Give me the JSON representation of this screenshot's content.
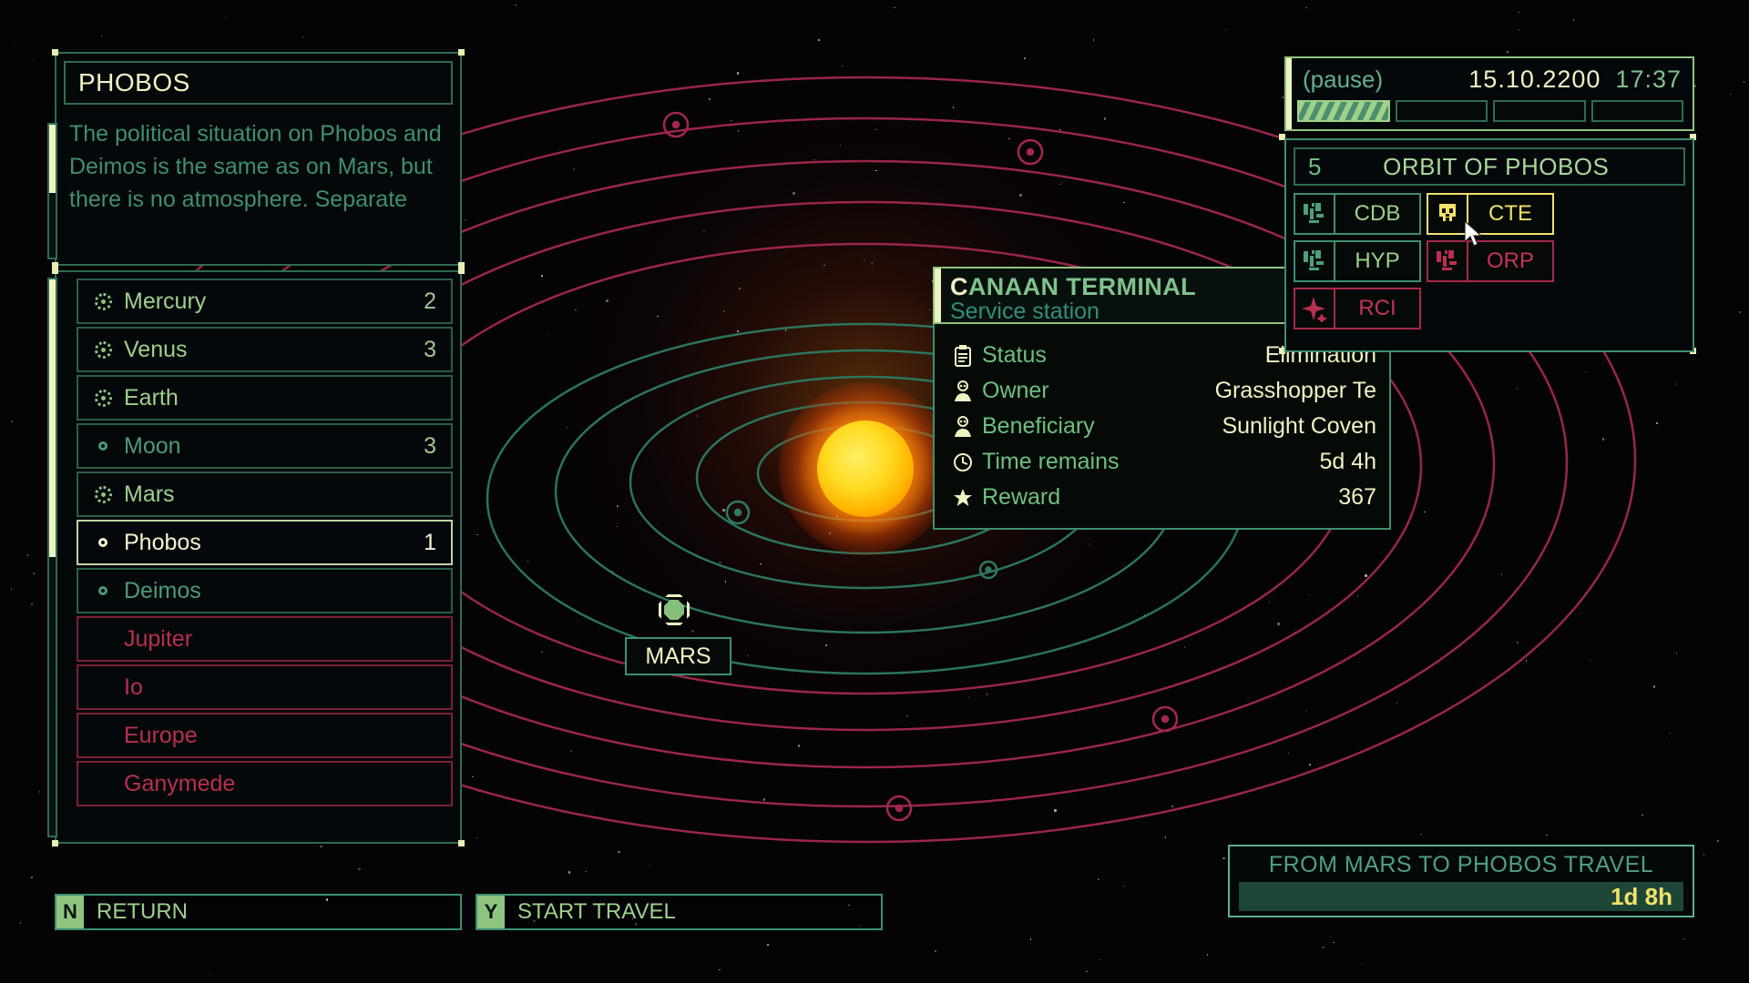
{
  "info_panel": {
    "title": "PHOBOS",
    "description": "The political situation on Phobos and Deimos is the same as on Mars, but there is no atmosphere. Separate"
  },
  "planet_list": {
    "items": [
      {
        "name": "Mercury",
        "value": "2",
        "icon": "planet-icon",
        "state": "planet"
      },
      {
        "name": "Venus",
        "value": "3",
        "icon": "planet-icon",
        "state": "planet"
      },
      {
        "name": "Earth",
        "value": "",
        "icon": "planet-icon",
        "state": "planet"
      },
      {
        "name": "Moon",
        "value": "3",
        "icon": "moon-icon",
        "state": "moon"
      },
      {
        "name": "Mars",
        "value": "",
        "icon": "planet-icon",
        "state": "planet"
      },
      {
        "name": "Phobos",
        "value": "1",
        "icon": "moon-icon",
        "state": "selected"
      },
      {
        "name": "Deimos",
        "value": "",
        "icon": "moon-icon",
        "state": "moon"
      },
      {
        "name": "Jupiter",
        "value": "",
        "icon": "none",
        "state": "locked"
      },
      {
        "name": "Io",
        "value": "",
        "icon": "none",
        "state": "locked"
      },
      {
        "name": "Europe",
        "value": "",
        "icon": "none",
        "state": "locked"
      },
      {
        "name": "Ganymede",
        "value": "",
        "icon": "none",
        "state": "locked"
      }
    ]
  },
  "actions": [
    {
      "key": "N",
      "label": "RETURN"
    },
    {
      "key": "Y",
      "label": "START TRAVEL"
    }
  ],
  "map": {
    "mars_label": "MARS"
  },
  "tooltip": {
    "name": "CANAAN TERMINAL",
    "subtitle": "Service station",
    "rows": [
      {
        "icon": "clipboard-icon",
        "label": "Status",
        "value": "Elimination"
      },
      {
        "icon": "person-icon",
        "label": "Owner",
        "value": "Grasshopper Te"
      },
      {
        "icon": "person-icon",
        "label": "Beneficiary",
        "value": "Sunlight Coven"
      },
      {
        "icon": "clock-icon",
        "label": "Time remains",
        "value": "5d 4h"
      },
      {
        "icon": "star-icon",
        "label": "Reward",
        "value": "367"
      }
    ]
  },
  "clock": {
    "pause_label": "(pause)",
    "date": "15.10.2200",
    "time": "17:37",
    "speed_segments": [
      true,
      false,
      false,
      false
    ]
  },
  "orbit_panel": {
    "number": "5",
    "title": "ORBIT OF PHOBOS",
    "factions": [
      {
        "code": "CDB",
        "state": "neutral",
        "icon": "faction-glyph-cdb"
      },
      {
        "code": "CTE",
        "state": "active",
        "icon": "skull-icon"
      },
      {
        "code": "HYP",
        "state": "neutral",
        "icon": "faction-glyph-hyp"
      },
      {
        "code": "ORP",
        "state": "hostile",
        "icon": "faction-glyph-orp"
      },
      {
        "code": "RCI",
        "state": "hostile",
        "icon": "faction-glyph-rci"
      }
    ]
  },
  "travel": {
    "title": "FROM MARS TO PHOBOS TRAVEL",
    "eta": "1d 8h"
  },
  "colors": {
    "green": "#3f8f70",
    "bright_green": "#9ed08c",
    "cream": "#edf3c2",
    "yellow": "#f2e06a",
    "red": "#b8304f",
    "background": "#040306"
  }
}
